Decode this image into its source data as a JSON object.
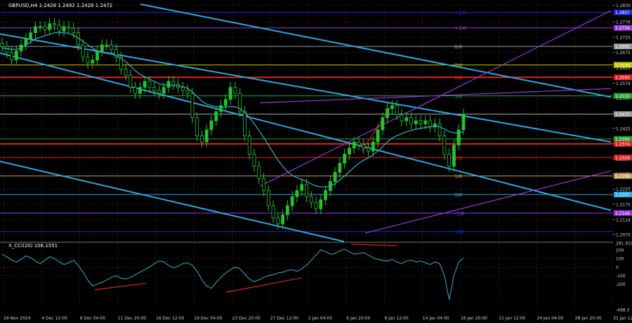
{
  "header": {
    "symbol_line": "GBPUSD,H4  1.2428 1.2492 1.2428 1.2472",
    "indicator_line": "X_CCI(20) 106.1551"
  },
  "colors": {
    "background": "#000000",
    "bull": "#22c32e",
    "bear": "#22c32e",
    "ma": "#36b1c4",
    "channel": "#2aa7e0",
    "purple": "#9a36dc",
    "red": "#e02020",
    "murrey_gray": "#9a9a9a",
    "murrey_orange": "#c8a15a",
    "cci": "#36b1c4",
    "divergence": "#e02020"
  },
  "chart_data": [
    {
      "type": "candlestick",
      "title": "GBPUSD,H4",
      "x_labels": [
        "29 Nov 2024",
        "4 Dec 12:00",
        "9 Dec 04:00",
        "11 Dec 20:00",
        "16 Dec 12:00",
        "19 Dec 04:00",
        "23 Dec 20:00",
        "27 Dec 12:00",
        "2 Jan 04:00",
        "6 Jan 20:00",
        "9 Jan 12:00",
        "14 Jan 04:00",
        "16 Jan 20:00",
        "21 Jan 12:00",
        "24 Jan 04:00",
        "28 Jan 20:00",
        "31 Jan 12:00"
      ],
      "ylim": [
        1.2052,
        1.2834
      ],
      "yticks": [
        "1.2830",
        "1.2776",
        "1.2725",
        "1.2675",
        "1.2625",
        "1.2574",
        "1.2525",
        "1.2475",
        "1.2425",
        "1.2374",
        "1.2324",
        "1.2275",
        "1.2225",
        "1.2175",
        "1.2124",
        "1.2075"
      ],
      "current_price": "1.2472",
      "price_tags": [
        {
          "value": 1.2807,
          "label": "1.2807",
          "color": "#1a2bd8"
        },
        {
          "value": 1.2756,
          "label": "1.2756",
          "color": "#9a36dc"
        },
        {
          "value": 1.2695,
          "label": "1.2695",
          "color": "#9a9a9a"
        },
        {
          "value": 1.2634,
          "label": "1.2634",
          "color": "#c8c800"
        },
        {
          "value": 1.2593,
          "label": "1.2593",
          "color": "#e02020"
        },
        {
          "value": 1.2532,
          "label": "1.2532",
          "color": "#22a22e"
        },
        {
          "value": 1.2472,
          "label": "1.2472",
          "color": "#9a9a9a"
        },
        {
          "value": 1.239,
          "label": "1.2390",
          "color": "#22a22e"
        },
        {
          "value": 1.2374,
          "label": "1.2374",
          "color": "#e02020"
        },
        {
          "value": 1.2329,
          "label": "1.2329",
          "color": "#e02020"
        },
        {
          "value": 1.2268,
          "label": "1.2268",
          "color": "#c8a15a"
        },
        {
          "value": 1.2207,
          "label": "1.2207",
          "color": "#2aa7e0"
        },
        {
          "value": 1.2146,
          "label": "1.2146",
          "color": "#9a36dc"
        }
      ],
      "murrey_levels": [
        {
          "value": 1.2807,
          "label": "+2/8",
          "color": "#1a2bd8"
        },
        {
          "value": 1.2756,
          "label": "+1/8",
          "color": "#9a36dc"
        },
        {
          "value": 1.2695,
          "label": "8/8",
          "color": "#9a9a9a"
        },
        {
          "value": 1.2634,
          "label": "7/8",
          "color": "#c8c800"
        },
        {
          "value": 1.2593,
          "label": "6/8",
          "color": "#e02020"
        },
        {
          "value": 1.2532,
          "label": "5/8",
          "color": "#22a22e"
        },
        {
          "value": 1.2472,
          "label": "",
          "color": "#9a9a9a"
        },
        {
          "value": 1.239,
          "label": "3/8",
          "color": "#22a22e"
        },
        {
          "value": 1.2329,
          "label": "2/8",
          "color": "#e02020"
        },
        {
          "value": 1.2268,
          "label": "1/8",
          "color": "#c8a15a"
        },
        {
          "value": 1.2207,
          "label": "0/8",
          "color": "#2aa7e0"
        },
        {
          "value": 1.2146,
          "label": "-1/8",
          "color": "#9a36dc"
        },
        {
          "value": 1.2085,
          "label": "-2/8",
          "color": "#1a2bd8"
        }
      ],
      "red_levels": [
        1.2593,
        1.2374
      ],
      "closes": [
        1.2695,
        1.2675,
        1.265,
        1.268,
        1.27,
        1.272,
        1.274,
        1.276,
        1.276,
        1.275,
        1.277,
        1.2765,
        1.2745,
        1.276,
        1.2755,
        1.274,
        1.27,
        1.266,
        1.264,
        1.265,
        1.268,
        1.27,
        1.27,
        1.2685,
        1.266,
        1.262,
        1.26,
        1.256,
        1.254,
        1.256,
        1.258,
        1.256,
        1.255,
        1.254,
        1.256,
        1.258,
        1.257,
        1.256,
        1.255,
        1.254,
        1.246,
        1.24,
        1.238,
        1.242,
        1.245,
        1.248,
        1.25,
        1.252,
        1.256,
        1.254,
        1.248,
        1.24,
        1.234,
        1.23,
        1.226,
        1.222,
        1.217,
        1.213,
        1.211,
        1.214,
        1.217,
        1.22,
        1.222,
        1.224,
        1.22,
        1.218,
        1.216,
        1.219,
        1.222,
        1.225,
        1.228,
        1.231,
        1.234,
        1.236,
        1.238,
        1.237,
        1.236,
        1.235,
        1.238,
        1.242,
        1.246,
        1.249,
        1.25,
        1.247,
        1.245,
        1.246,
        1.244,
        1.245,
        1.244,
        1.245,
        1.243,
        1.244,
        1.24,
        1.234,
        1.23,
        1.237,
        1.242,
        1.2472
      ],
      "ma": [
        1.269,
        1.2688,
        1.2685,
        1.2685,
        1.269,
        1.27,
        1.271,
        1.272,
        1.2725,
        1.273,
        1.2735,
        1.274,
        1.274,
        1.274,
        1.2738,
        1.2732,
        1.2722,
        1.2712,
        1.27,
        1.269,
        1.268,
        1.2675,
        1.2672,
        1.267,
        1.2665,
        1.2655,
        1.2645,
        1.263,
        1.2615,
        1.2603,
        1.2595,
        1.2587,
        1.258,
        1.2572,
        1.2568,
        1.2567,
        1.2566,
        1.2565,
        1.2562,
        1.2557,
        1.2545,
        1.253,
        1.2515,
        1.2505,
        1.25,
        1.2497,
        1.2495,
        1.2495,
        1.2497,
        1.2496,
        1.249,
        1.2477,
        1.246,
        1.244,
        1.2418,
        1.2395,
        1.237,
        1.2345,
        1.232,
        1.23,
        1.2283,
        1.227,
        1.2262,
        1.2257,
        1.225,
        1.2242,
        1.2235,
        1.2232,
        1.2232,
        1.2235,
        1.2243,
        1.2255,
        1.2268,
        1.2282,
        1.2297,
        1.231,
        1.232,
        1.2328,
        1.2338,
        1.235,
        1.2365,
        1.238,
        1.2393,
        1.2401,
        1.2407,
        1.2414,
        1.2418,
        1.2422,
        1.2425,
        1.2428,
        1.243,
        1.2432,
        1.243,
        1.2423,
        1.2414,
        1.241,
        1.241,
        1.2414
      ],
      "trendlines": [
        {
          "kind": "channel",
          "points": [
            [
              0,
              1.2736
            ],
            [
              870,
              1.238
            ]
          ]
        },
        {
          "kind": "channel",
          "points": [
            [
              200,
              1.2834
            ],
            [
              870,
              1.2528
            ]
          ]
        },
        {
          "kind": "channel",
          "points": [
            [
              0,
              1.2316
            ],
            [
              490,
              1.2052
            ]
          ]
        },
        {
          "kind": "channel",
          "points": [
            [
              0,
              1.2673
            ],
            [
              870,
              1.2155
            ]
          ]
        },
        {
          "kind": "purple",
          "points": [
            [
              370,
              1.2234
            ],
            [
              870,
              1.2813
            ]
          ]
        },
        {
          "kind": "purple",
          "points": [
            [
              370,
              1.2509
            ],
            [
              870,
              1.2556
            ]
          ]
        },
        {
          "kind": "purple",
          "points": [
            [
              520,
              1.208
            ],
            [
              870,
              1.2285
            ]
          ]
        },
        {
          "kind": "red",
          "points": [
            [
              515,
              1.235
            ],
            [
              555,
              1.249
            ]
          ]
        }
      ]
    },
    {
      "type": "line",
      "title": "X_CCI(20) 106.1551",
      "ylim": [
        -498.3,
        281.9
      ],
      "yticks": [
        "281.9197",
        "200",
        "100",
        "0",
        "-100",
        "-200",
        "-498.3"
      ],
      "cci": [
        150,
        120,
        80,
        60,
        90,
        130,
        110,
        70,
        40,
        80,
        120,
        100,
        60,
        30,
        50,
        80,
        20,
        -60,
        -150,
        -220,
        -200,
        -180,
        -150,
        -120,
        -100,
        -130,
        -140,
        -120,
        -90,
        -60,
        -30,
        0,
        40,
        70,
        60,
        20,
        -10,
        10,
        40,
        50,
        20,
        -50,
        -150,
        -220,
        -250,
        -180,
        -120,
        -70,
        -30,
        0,
        -20,
        -80,
        -140,
        -170,
        -150,
        -120,
        -100,
        -90,
        -70,
        -60,
        -40,
        -30,
        -50,
        -20,
        20,
        80,
        140,
        200,
        180,
        150,
        160,
        190,
        210,
        180,
        150,
        160,
        170,
        140,
        110,
        90,
        80,
        70,
        90,
        60,
        40,
        70,
        80,
        60,
        70,
        50,
        30,
        60,
        40,
        -100,
        -380,
        -100,
        60,
        106.2
      ],
      "divergences": [
        {
          "points": [
            [
              135,
              -265
            ],
            [
              208,
              -190
            ]
          ]
        },
        {
          "points": [
            [
              322,
              -295
            ],
            [
              430,
              -125
            ]
          ]
        },
        {
          "points": [
            [
              500,
              268
            ],
            [
              565,
              250
            ]
          ]
        }
      ]
    }
  ],
  "x_axis_labels": [
    "29 Nov 2024",
    "4 Dec 12:00",
    "9 Dec 04:00",
    "11 Dec 20:00",
    "16 Dec 12:00",
    "19 Dec 04:00",
    "23 Dec 20:00",
    "27 Dec 12:00",
    "2 Jan 04:00",
    "6 Jan 20:00",
    "9 Jan 12:00",
    "14 Jan 04:00",
    "16 Jan 20:00",
    "21 Jan 12:00",
    "24 Jan 04:00",
    "28 Jan 20:00",
    "31 Jan 12:00"
  ]
}
